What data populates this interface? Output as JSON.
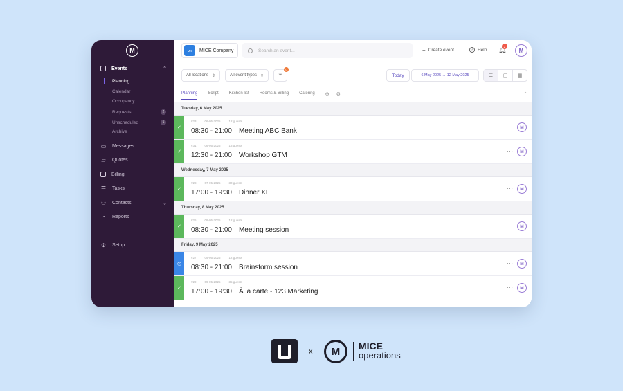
{
  "sidebar": {
    "logo": "M",
    "items": [
      {
        "label": "Events",
        "icon": "calendar-icon"
      },
      {
        "label": "Messages",
        "icon": "chat-icon"
      },
      {
        "label": "Quotes",
        "icon": "folder-icon"
      },
      {
        "label": "Billing",
        "icon": "invoice-icon"
      },
      {
        "label": "Tasks",
        "icon": "checklist-icon"
      },
      {
        "label": "Contacts",
        "icon": "people-icon"
      },
      {
        "label": "Reports",
        "icon": "chart-icon"
      },
      {
        "label": "Setup",
        "icon": "gear-icon"
      }
    ],
    "event_sub": [
      {
        "label": "Planning"
      },
      {
        "label": "Calendar"
      },
      {
        "label": "Occupancy"
      },
      {
        "label": "Requests",
        "badge": "2"
      },
      {
        "label": "Unscheduled",
        "badge": "1"
      },
      {
        "label": "Archive"
      }
    ]
  },
  "topbar": {
    "company_badge": "MK",
    "company": "MICE Company",
    "search_placeholder": "Search an event...",
    "create_event": "Create event",
    "help": "Help",
    "notifications": "2",
    "avatar": "M"
  },
  "filters": {
    "locations": "All locations",
    "event_types": "All event types",
    "filter_count": "0",
    "today": "Today",
    "date_range": "6 May 2025  →  12 May 2025"
  },
  "tabs": [
    "Planning",
    "Script",
    "Kitchen list",
    "Rooms & Billing",
    "Catering"
  ],
  "days": [
    {
      "header": "Tuesday, 6 May 2025",
      "events": [
        {
          "id": "#23",
          "date": "06-05-2025",
          "guests": "12 guests",
          "time": "08:30 - 21:00",
          "title": "Meeting ABC Bank",
          "status": "confirmed"
        },
        {
          "id": "#31",
          "date": "06-05-2025",
          "guests": "18 guests",
          "time": "12:30 - 21:00",
          "title": "Workshop GTM",
          "status": "confirmed"
        }
      ]
    },
    {
      "header": "Wednesday, 7 May 2025",
      "events": [
        {
          "id": "#28",
          "date": "07-05-2025",
          "guests": "30 guests",
          "time": "17:00 - 19:30",
          "title": "Dinner XL",
          "status": "confirmed"
        }
      ]
    },
    {
      "header": "Thursday, 8 May 2025",
      "events": [
        {
          "id": "#26",
          "date": "08-05-2025",
          "guests": "12 guests",
          "time": "08:30 - 21:00",
          "title": "Meeting session",
          "status": "confirmed"
        }
      ]
    },
    {
      "header": "Friday, 9 May 2025",
      "events": [
        {
          "id": "#27",
          "date": "09-05-2025",
          "guests": "12 guests",
          "time": "08:30 - 21:00",
          "title": "Brainstorm session",
          "status": "pending"
        },
        {
          "id": "#29",
          "date": "09-05-2025",
          "guests": "35 guests",
          "time": "17:00 - 19:30",
          "title": "À la carte - 123 Marketing",
          "status": "confirmed"
        }
      ]
    }
  ],
  "footer": {
    "times": "x",
    "brand_title": "MICE",
    "brand_sub": "operations",
    "brand_mark": "M"
  },
  "colors": {
    "sidebar_bg": "#2e1a38",
    "accent": "#5a4bbf",
    "confirmed": "#5cb85c",
    "pending": "#3a86e6",
    "page_bg": "#cfe4fa"
  }
}
